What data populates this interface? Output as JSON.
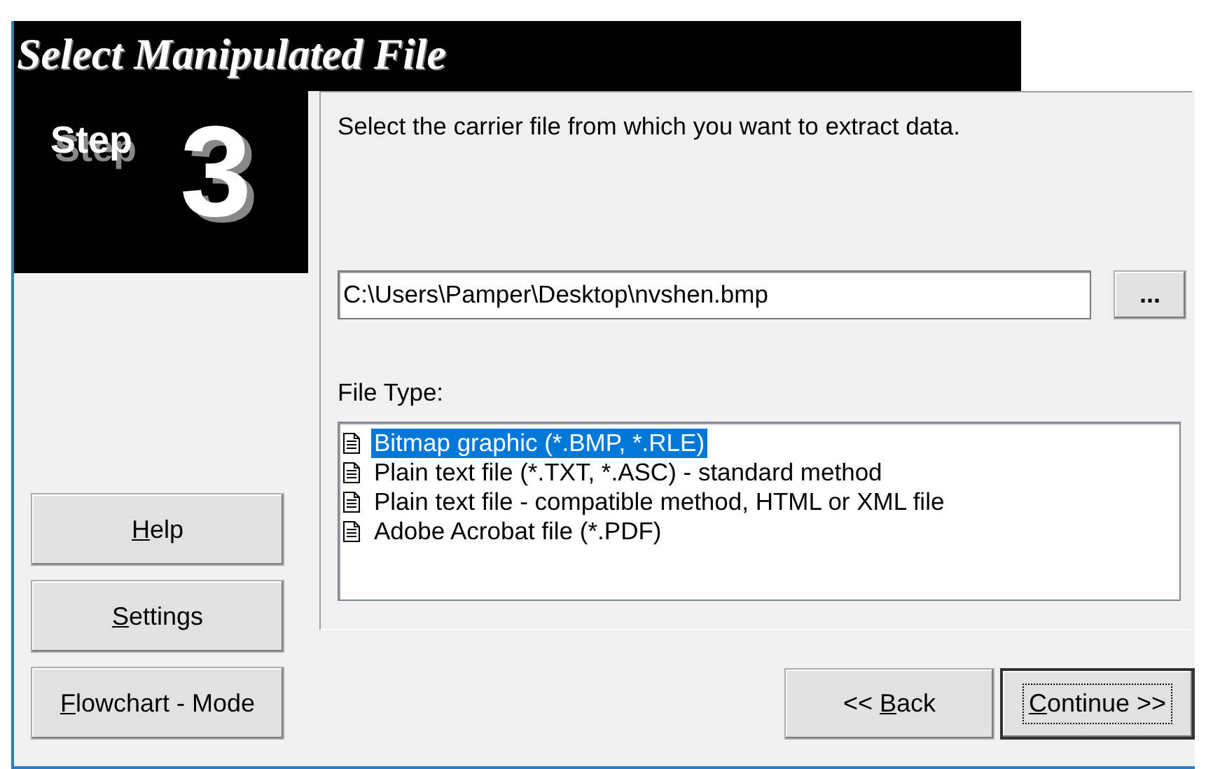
{
  "title": "Select Manipulated File",
  "step": {
    "label": "Step",
    "number": "3"
  },
  "instruction": "Select the carrier file from which you want to extract data.",
  "path_field": {
    "value": "C:\\Users\\Pamper\\Desktop\\nvshen.bmp"
  },
  "browse_button": {
    "label": "..."
  },
  "file_type": {
    "label": "File Type:",
    "items": [
      {
        "label": "Bitmap graphic (*.BMP, *.RLE)",
        "selected": true
      },
      {
        "label": "Plain text file (*.TXT, *.ASC) - standard method",
        "selected": false
      },
      {
        "label": "Plain text file - compatible method, HTML or XML file",
        "selected": false
      },
      {
        "label": "Adobe Acrobat file (*.PDF)",
        "selected": false
      }
    ]
  },
  "side_buttons": [
    {
      "key": "H",
      "suffix": "elp",
      "focused": false
    },
    {
      "key": "S",
      "suffix": "ettings",
      "focused": false
    },
    {
      "key": "F",
      "suffix": "lowchart - Mode",
      "focused": false
    }
  ],
  "nav_buttons": [
    {
      "prefix": "<< ",
      "key": "B",
      "suffix": "ack",
      "focused": false
    },
    {
      "key": "C",
      "suffix": "ontinue >>",
      "focused": true
    }
  ]
}
